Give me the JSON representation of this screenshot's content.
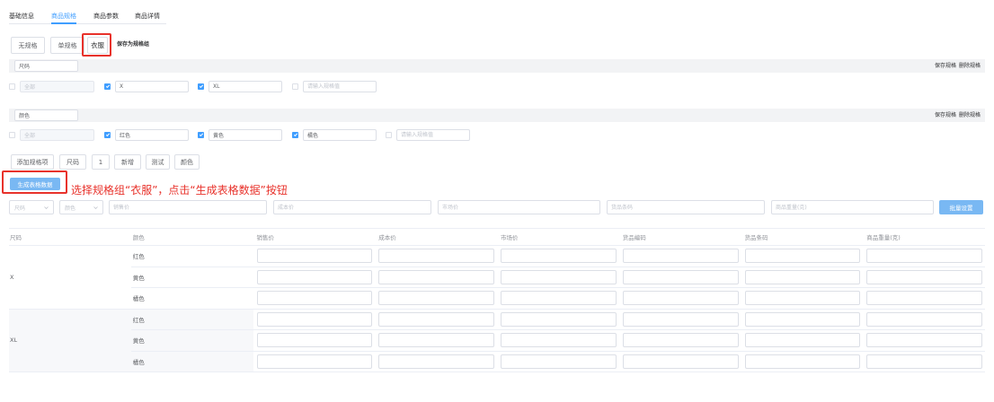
{
  "colors": {
    "accent": "#409eff",
    "button_light": "#79b8f3",
    "annotation": "#e8322b"
  },
  "icons": {
    "select_arrow": "chevron-down-icon",
    "checkbox_mark": "check-icon"
  },
  "tabs": [
    {
      "label": "基础信息",
      "active": false
    },
    {
      "label": "商品规格",
      "active": true
    },
    {
      "label": "商品参数",
      "active": false
    },
    {
      "label": "商品详情",
      "active": false
    }
  ],
  "spec_mode": {
    "options": [
      "无规格",
      "单规格",
      "衣服"
    ],
    "save_group_label": "保存为规格组"
  },
  "spec_items": [
    {
      "name": "尺码",
      "save_label": "保存规格",
      "delete_label": "删除规格",
      "all": {
        "label": "全部",
        "checked": false
      },
      "values": [
        {
          "value": "X",
          "checked": true
        },
        {
          "value": "XL",
          "checked": true
        }
      ],
      "new_value": {
        "placeholder": "请输入规格值",
        "checked": false
      }
    },
    {
      "name": "颜色",
      "save_label": "保存规格",
      "delete_label": "删除规格",
      "all": {
        "label": "全部",
        "checked": false
      },
      "values": [
        {
          "value": "红色",
          "checked": true
        },
        {
          "value": "黄色",
          "checked": true
        },
        {
          "value": "橘色",
          "checked": true
        }
      ],
      "new_value": {
        "placeholder": "请输入规格值",
        "checked": false
      }
    }
  ],
  "spec_tags": [
    "添加规格项",
    "尺码",
    "1",
    "新增",
    "测试",
    "颜色"
  ],
  "generate_button": "生成表格数据",
  "annotation": "选择规格组“衣服”，点击“生成表格数据”按钮",
  "batch": {
    "selects": [
      {
        "placeholder": "尺码"
      },
      {
        "placeholder": "颜色"
      }
    ],
    "inputs": [
      {
        "placeholder": "销售价"
      },
      {
        "placeholder": "成本价"
      },
      {
        "placeholder": "市场价"
      },
      {
        "placeholder": "货品条码"
      },
      {
        "placeholder": "商品重量(克)"
      }
    ],
    "button": "批量设置"
  },
  "table": {
    "headers": [
      "尺码",
      "颜色",
      "销售价",
      "成本价",
      "市场价",
      "货品编码",
      "货品条码",
      "商品重量(克)"
    ],
    "groups": [
      {
        "size": "X",
        "colors": [
          "红色",
          "黄色",
          "橘色"
        ]
      },
      {
        "size": "XL",
        "colors": [
          "红色",
          "黄色",
          "橘色"
        ]
      }
    ]
  }
}
